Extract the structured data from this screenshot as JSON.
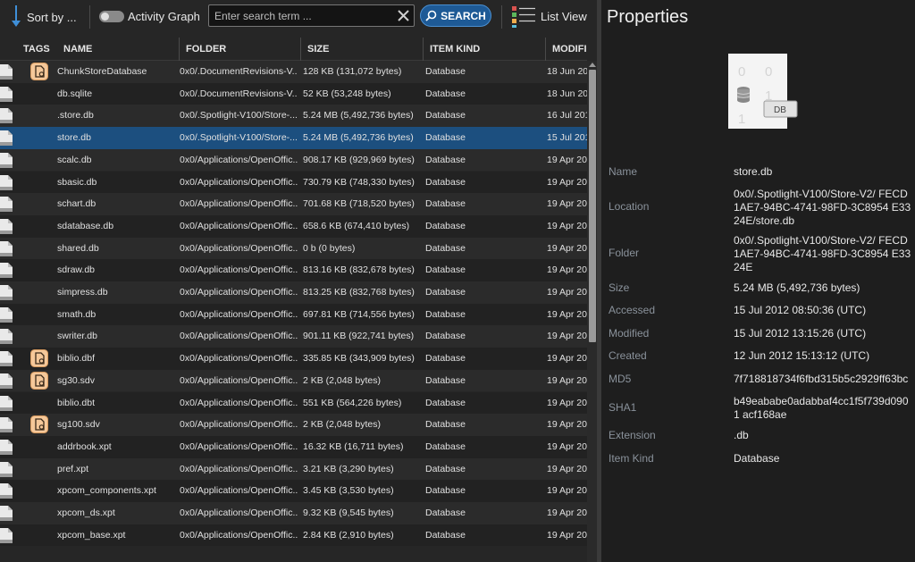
{
  "toolbar": {
    "sort_label": "Sort by ...",
    "activity_graph_label": "Activity Graph",
    "search_placeholder": "Enter search term ...",
    "search_button_label": "SEARCH",
    "list_view_label": "List View"
  },
  "columns": {
    "tags": "TAGS",
    "name": "NAME",
    "folder": "FOLDER",
    "size": "SIZE",
    "item_kind": "ITEM KIND",
    "modified": "MODIFI"
  },
  "rows": [
    {
      "name": "ChunkStoreDatabase",
      "folder": "0x0/.DocumentRevisions-V...",
      "size": "128 KB (131,072 bytes)",
      "kind": "Database",
      "modified": "18 Jun 20",
      "tagged": true,
      "selected": false
    },
    {
      "name": "db.sqlite",
      "folder": "0x0/.DocumentRevisions-V...",
      "size": "52 KB (53,248 bytes)",
      "kind": "Database",
      "modified": "18 Jun 20",
      "tagged": false,
      "selected": false
    },
    {
      "name": ".store.db",
      "folder": "0x0/.Spotlight-V100/Store-...",
      "size": "5.24 MB (5,492,736 bytes)",
      "kind": "Database",
      "modified": "16 Jul 201",
      "tagged": false,
      "selected": false
    },
    {
      "name": "store.db",
      "folder": "0x0/.Spotlight-V100/Store-...",
      "size": "5.24 MB (5,492,736 bytes)",
      "kind": "Database",
      "modified": "15 Jul 201",
      "tagged": false,
      "selected": true
    },
    {
      "name": "scalc.db",
      "folder": "0x0/Applications/OpenOffic...",
      "size": "908.17 KB (929,969 bytes)",
      "kind": "Database",
      "modified": "19 Apr 20",
      "tagged": false,
      "selected": false
    },
    {
      "name": "sbasic.db",
      "folder": "0x0/Applications/OpenOffic...",
      "size": "730.79 KB (748,330 bytes)",
      "kind": "Database",
      "modified": "19 Apr 20",
      "tagged": false,
      "selected": false
    },
    {
      "name": "schart.db",
      "folder": "0x0/Applications/OpenOffic...",
      "size": "701.68 KB (718,520 bytes)",
      "kind": "Database",
      "modified": "19 Apr 20",
      "tagged": false,
      "selected": false
    },
    {
      "name": "sdatabase.db",
      "folder": "0x0/Applications/OpenOffic...",
      "size": "658.6 KB (674,410 bytes)",
      "kind": "Database",
      "modified": "19 Apr 20",
      "tagged": false,
      "selected": false
    },
    {
      "name": "shared.db",
      "folder": "0x0/Applications/OpenOffic...",
      "size": "0 b (0 bytes)",
      "kind": "Database",
      "modified": "19 Apr 20",
      "tagged": false,
      "selected": false
    },
    {
      "name": "sdraw.db",
      "folder": "0x0/Applications/OpenOffic...",
      "size": "813.16 KB (832,678 bytes)",
      "kind": "Database",
      "modified": "19 Apr 20",
      "tagged": false,
      "selected": false
    },
    {
      "name": "simpress.db",
      "folder": "0x0/Applications/OpenOffic...",
      "size": "813.25 KB (832,768 bytes)",
      "kind": "Database",
      "modified": "19 Apr 20",
      "tagged": false,
      "selected": false
    },
    {
      "name": "smath.db",
      "folder": "0x0/Applications/OpenOffic...",
      "size": "697.81 KB (714,556 bytes)",
      "kind": "Database",
      "modified": "19 Apr 20",
      "tagged": false,
      "selected": false
    },
    {
      "name": "swriter.db",
      "folder": "0x0/Applications/OpenOffic...",
      "size": "901.11 KB (922,741 bytes)",
      "kind": "Database",
      "modified": "19 Apr 20",
      "tagged": false,
      "selected": false
    },
    {
      "name": "biblio.dbf",
      "folder": "0x0/Applications/OpenOffic...",
      "size": "335.85 KB (343,909 bytes)",
      "kind": "Database",
      "modified": "19 Apr 20",
      "tagged": true,
      "selected": false
    },
    {
      "name": "sg30.sdv",
      "folder": "0x0/Applications/OpenOffic...",
      "size": "2 KB (2,048 bytes)",
      "kind": "Database",
      "modified": "19 Apr 20",
      "tagged": true,
      "selected": false
    },
    {
      "name": "biblio.dbt",
      "folder": "0x0/Applications/OpenOffic...",
      "size": "551 KB (564,226 bytes)",
      "kind": "Database",
      "modified": "19 Apr 20",
      "tagged": false,
      "selected": false
    },
    {
      "name": "sg100.sdv",
      "folder": "0x0/Applications/OpenOffic...",
      "size": "2 KB (2,048 bytes)",
      "kind": "Database",
      "modified": "19 Apr 20",
      "tagged": true,
      "selected": false
    },
    {
      "name": "addrbook.xpt",
      "folder": "0x0/Applications/OpenOffic...",
      "size": "16.32 KB (16,711 bytes)",
      "kind": "Database",
      "modified": "19 Apr 20",
      "tagged": false,
      "selected": false
    },
    {
      "name": "pref.xpt",
      "folder": "0x0/Applications/OpenOffic...",
      "size": "3.21 KB (3,290 bytes)",
      "kind": "Database",
      "modified": "19 Apr 20",
      "tagged": false,
      "selected": false
    },
    {
      "name": "xpcom_components.xpt",
      "folder": "0x0/Applications/OpenOffic...",
      "size": "3.45 KB (3,530 bytes)",
      "kind": "Database",
      "modified": "19 Apr 20",
      "tagged": false,
      "selected": false
    },
    {
      "name": "xpcom_ds.xpt",
      "folder": "0x0/Applications/OpenOffic...",
      "size": "9.32 KB (9,545 bytes)",
      "kind": "Database",
      "modified": "19 Apr 20",
      "tagged": false,
      "selected": false
    },
    {
      "name": "xpcom_base.xpt",
      "folder": "0x0/Applications/OpenOffic...",
      "size": "2.84 KB (2,910 bytes)",
      "kind": "Database",
      "modified": "19 Apr 20",
      "tagged": false,
      "selected": false
    }
  ],
  "properties": {
    "title": "Properties",
    "preview_badge": "DB",
    "preview_digits": [
      "0",
      "0",
      "1",
      "1"
    ],
    "fields": [
      {
        "label": "Name",
        "value": "store.db"
      },
      {
        "label": "Location",
        "value": "0x0/.Spotlight-V100/Store-V2/ FECD1AE7-94BC-4741-98FD-3C8954 E3324E/store.db"
      },
      {
        "label": "Folder",
        "value": "0x0/.Spotlight-V100/Store-V2/ FECD1AE7-94BC-4741-98FD-3C8954 E3324E"
      },
      {
        "label": "Size",
        "value": "5.24 MB (5,492,736 bytes)"
      },
      {
        "label": "Accessed",
        "value": "15 Jul 2012 08:50:36 (UTC)"
      },
      {
        "label": "Modified",
        "value": "15 Jul 2012 13:15:26 (UTC)"
      },
      {
        "label": "Created",
        "value": "12 Jun 2012 15:13:12 (UTC)"
      },
      {
        "label": "MD5",
        "value": "7f718818734f6fbd315b5c2929ff63bc"
      },
      {
        "label": "SHA1",
        "value": "b49eababe0adabbaf4cc1f5f739d0901 acf168ae"
      },
      {
        "label": "Extension",
        "value": ".db"
      },
      {
        "label": "Item Kind",
        "value": "Database"
      }
    ]
  },
  "colors": {
    "accent": "#1e5a96",
    "selected_row": "#1c4f7f",
    "tag": "#f5c89a"
  },
  "icons": {
    "sort": "sort-descending-icon",
    "clear": "clear-icon",
    "search": "search-icon",
    "list_view": "list-view-icon",
    "file": "file-icon",
    "tag": "tag-icon",
    "database": "database-icon"
  }
}
